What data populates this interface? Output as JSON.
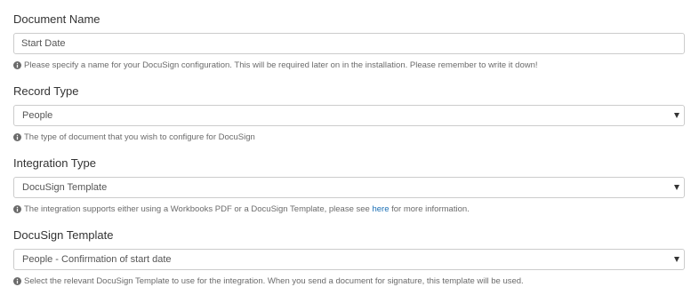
{
  "fields": {
    "document_name": {
      "label": "Document Name",
      "value": "Start Date",
      "help": "Please specify a name for your DocuSign configuration. This will be required later on in the installation. Please remember to write it down!"
    },
    "record_type": {
      "label": "Record Type",
      "selected": "People",
      "help": "The type of document that you wish to configure for DocuSign"
    },
    "integration_type": {
      "label": "Integration Type",
      "selected": "DocuSign Template",
      "help_before": "The integration supports either using a Workbooks PDF or a DocuSign Template, please see ",
      "help_link": "here",
      "help_after": " for more information."
    },
    "docusign_template": {
      "label": "DocuSign Template",
      "selected": "People - Confirmation of start date",
      "help": "Select the relevant DocuSign Template to use for the integration. When you send a document for signature, this template will be used."
    }
  },
  "icons": {
    "info": "info-circle-icon",
    "dropdown": "caret-down-icon"
  },
  "colors": {
    "link": "#1a6fb5",
    "border": "#cccccc",
    "help_text": "#6b6b6b"
  }
}
